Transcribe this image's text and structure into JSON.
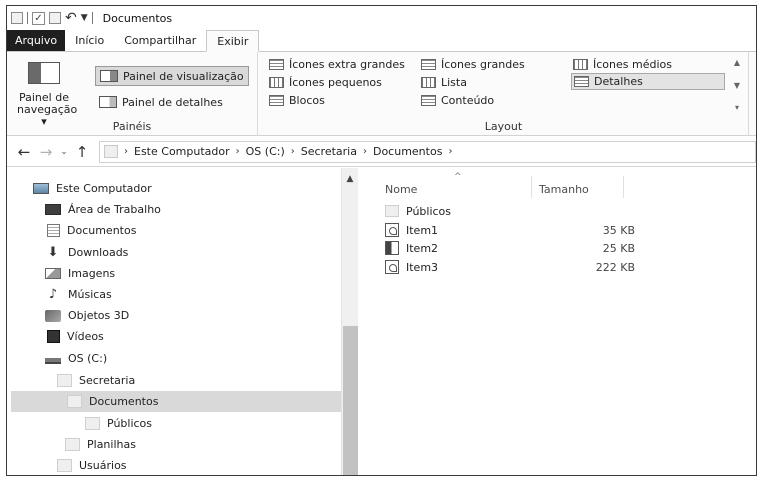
{
  "window": {
    "title": "Documentos"
  },
  "ribbon_tabs": [
    "Arquivo",
    "Início",
    "Compartilhar",
    "Exibir"
  ],
  "ribbon": {
    "paineis": {
      "label": "Painéis",
      "nav_pane_label_1": "Painel de",
      "nav_pane_label_2": "navegação ▾",
      "preview_pane": "Painel de visualização",
      "details_pane": "Painel de detalhes"
    },
    "layout": {
      "label": "Layout",
      "items": [
        "Ícones extra grandes",
        "Ícones grandes",
        "Ícones médios",
        "Ícones pequenos",
        "Lista",
        "Detalhes",
        "Blocos",
        "Conteúdo"
      ],
      "selected": "Detalhes"
    }
  },
  "address": {
    "crumbs": [
      "Este Computador",
      "OS (C:)",
      "Secretaria",
      "Documentos"
    ]
  },
  "navigation_pane": {
    "items": [
      {
        "label": "Este Computador",
        "icon": "computer-icon"
      },
      {
        "label": "Área de Trabalho",
        "icon": "desktop-icon"
      },
      {
        "label": "Documentos",
        "icon": "document-icon"
      },
      {
        "label": "Downloads",
        "icon": "download-arrow-icon"
      },
      {
        "label": "Imagens",
        "icon": "pictures-icon"
      },
      {
        "label": "Músicas",
        "icon": "music-note-icon"
      },
      {
        "label": "Objetos 3D",
        "icon": "3d-object-icon"
      },
      {
        "label": "Vídeos",
        "icon": "video-icon"
      },
      {
        "label": "OS (C:)",
        "icon": "drive-icon"
      },
      {
        "label": "Secretaria",
        "icon": "folder-icon"
      },
      {
        "label": "Documentos",
        "icon": "folder-icon",
        "selected": true
      },
      {
        "label": "Públicos",
        "icon": "folder-icon"
      },
      {
        "label": "Planilhas",
        "icon": "folder-icon"
      },
      {
        "label": "Usuários",
        "icon": "folder-icon"
      }
    ]
  },
  "file_list": {
    "columns": [
      "Nome",
      "Tamanho"
    ],
    "rows": [
      {
        "name": "Públicos",
        "size": "",
        "icon": "folder-icon"
      },
      {
        "name": "Item1",
        "size": "35 KB",
        "icon": "pdf-file-icon"
      },
      {
        "name": "Item2",
        "size": "25 KB",
        "icon": "word-file-icon"
      },
      {
        "name": "Item3",
        "size": "222 KB",
        "icon": "pdf-file-icon"
      }
    ]
  }
}
